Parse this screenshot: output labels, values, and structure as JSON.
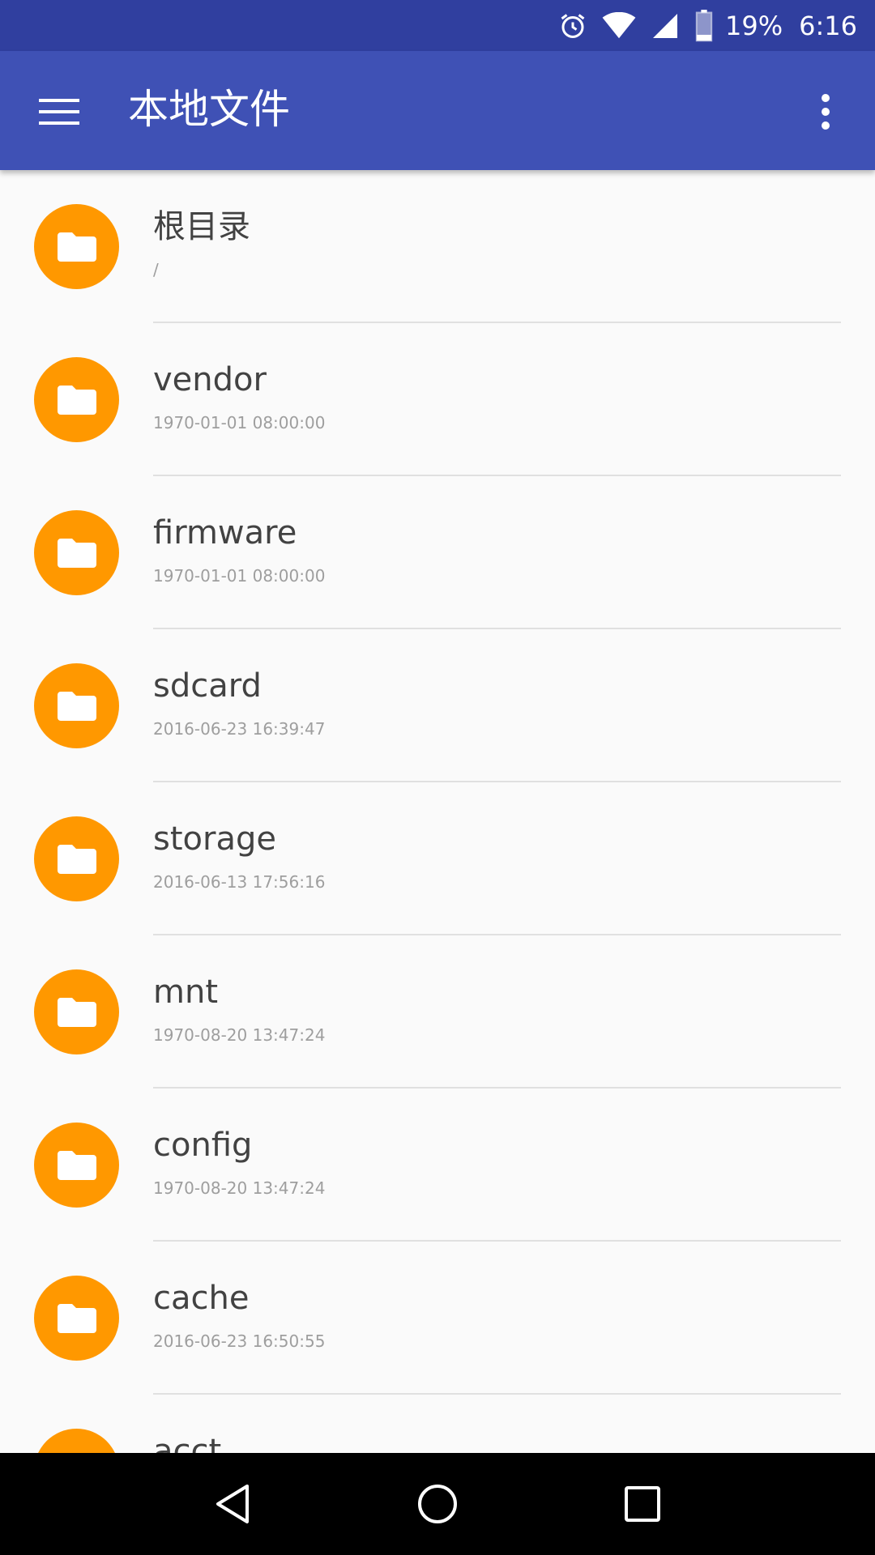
{
  "status_bar": {
    "battery_percent": "19%",
    "time": "6:16",
    "icons": [
      "alarm-icon",
      "wifi-icon",
      "signal-icon",
      "battery-icon"
    ]
  },
  "app_bar": {
    "title": "本地文件",
    "menu_icon": "hamburger-menu-icon",
    "more_icon": "more-vert-icon"
  },
  "colors": {
    "status_bar": "#303f9f",
    "app_bar": "#3f51b5",
    "folder_avatar": "#ff9800",
    "background": "#fafafa"
  },
  "files": [
    {
      "name": "根目录",
      "meta": "/"
    },
    {
      "name": "vendor",
      "meta": "1970-01-01 08:00:00"
    },
    {
      "name": "firmware",
      "meta": "1970-01-01 08:00:00"
    },
    {
      "name": "sdcard",
      "meta": "2016-06-23 16:39:47"
    },
    {
      "name": "storage",
      "meta": "2016-06-13 17:56:16"
    },
    {
      "name": "mnt",
      "meta": "1970-08-20 13:47:24"
    },
    {
      "name": "config",
      "meta": "1970-08-20 13:47:24"
    },
    {
      "name": "cache",
      "meta": "2016-06-23 16:50:55"
    },
    {
      "name": "acct",
      "meta": ""
    }
  ],
  "nav_bar": {
    "icons": [
      "back-icon",
      "home-icon",
      "recents-icon"
    ]
  }
}
